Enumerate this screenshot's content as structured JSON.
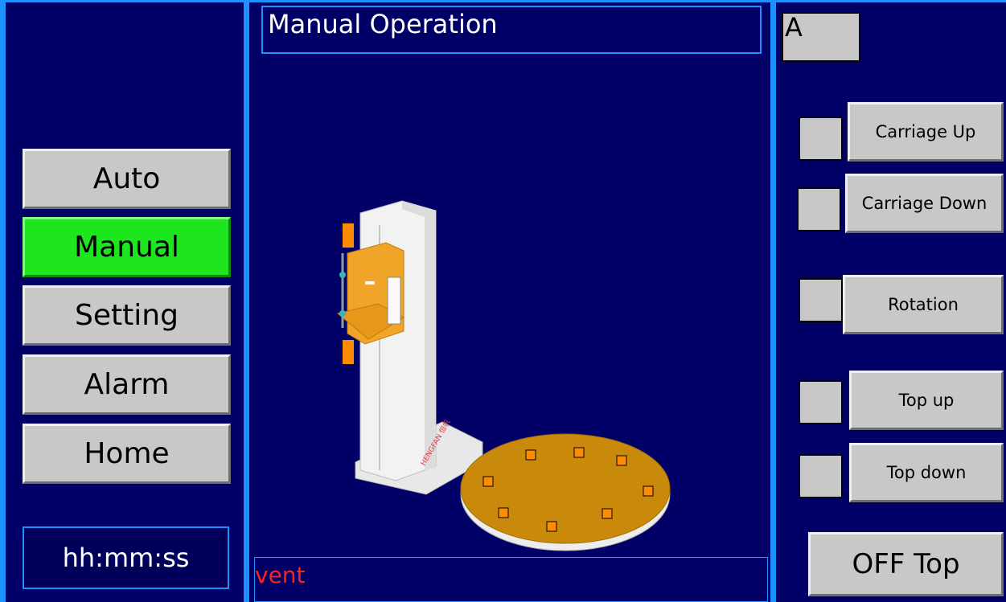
{
  "header": {
    "title": "Manual Operation",
    "mode_indicator": "A"
  },
  "nav": {
    "items": [
      {
        "label": "Auto"
      },
      {
        "label": "Manual",
        "active": true
      },
      {
        "label": "Setting"
      },
      {
        "label": "Alarm"
      },
      {
        "label": "Home"
      }
    ]
  },
  "clock": {
    "text": "hh:mm:ss"
  },
  "event": {
    "text": "vent"
  },
  "controls": {
    "carriage_up": "Carriage Up",
    "carriage_down": "Carriage Down",
    "rotation": "Rotation",
    "top_up": "Top up",
    "top_down": "Top down",
    "off_top": "OFF Top"
  },
  "machine": {
    "brand_text": "HENGFAN 恒帆"
  },
  "colors": {
    "background": "#000066",
    "accent": "#1e90ff",
    "active_nav": "#1ee61e",
    "button": "#c8c8c8",
    "event_text": "#ff2020",
    "sensor": "#ff8c00"
  }
}
